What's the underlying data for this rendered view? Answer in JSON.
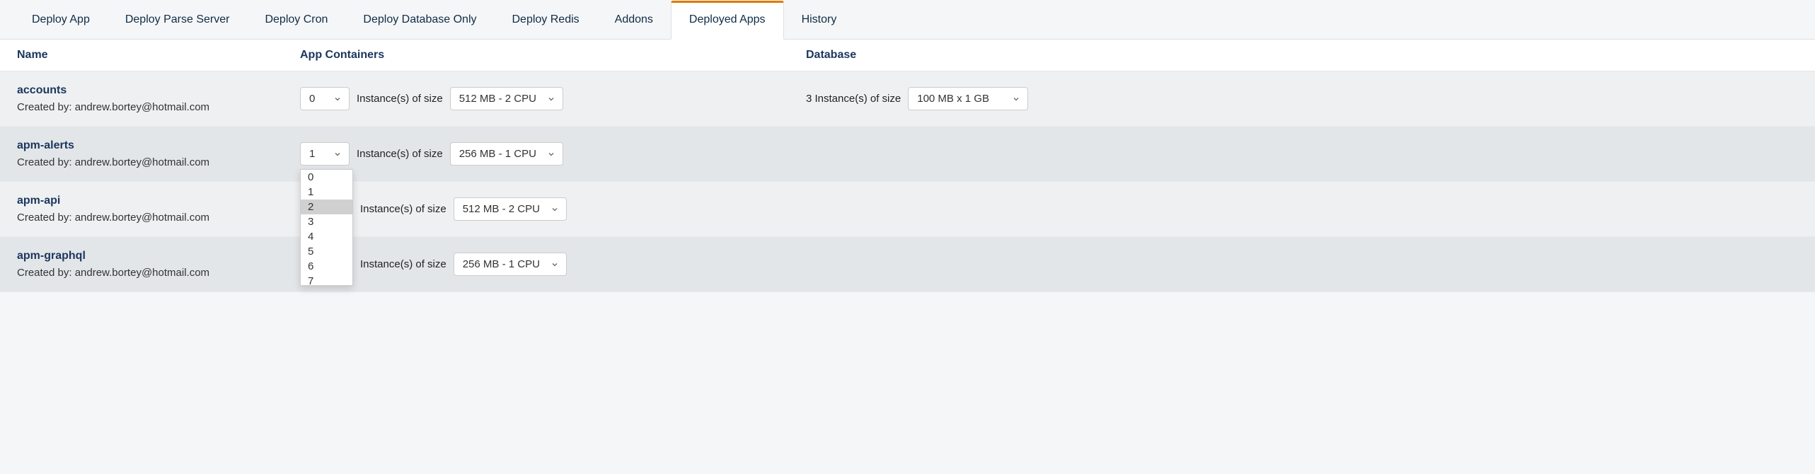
{
  "tabs": [
    {
      "label": "Deploy App",
      "active": false
    },
    {
      "label": "Deploy Parse Server",
      "active": false
    },
    {
      "label": "Deploy Cron",
      "active": false
    },
    {
      "label": "Deploy Database Only",
      "active": false
    },
    {
      "label": "Deploy Redis",
      "active": false
    },
    {
      "label": "Addons",
      "active": false
    },
    {
      "label": "Deployed Apps",
      "active": true
    },
    {
      "label": "History",
      "active": false
    }
  ],
  "headers": {
    "name": "Name",
    "containers": "App Containers",
    "database": "Database"
  },
  "created_by_prefix": "Created by: ",
  "instances_label": "Instance(s) of size",
  "db_instances_prefix": "3 Instance(s) of size",
  "dropdown_options": [
    "0",
    "1",
    "2",
    "3",
    "4",
    "5",
    "6",
    "7"
  ],
  "dropdown_highlight_index": 2,
  "apps": [
    {
      "name": "accounts",
      "created_by": "andrew.bortey@hotmail.com",
      "count": "0",
      "size": "512 MB - 2 CPU",
      "db_size": "100 MB x 1 GB",
      "show_db": true,
      "dropdown_open": false
    },
    {
      "name": "apm-alerts",
      "created_by": "andrew.bortey@hotmail.com",
      "count": "1",
      "size": "256 MB - 1 CPU",
      "show_db": false,
      "dropdown_open": true
    },
    {
      "name": "apm-api",
      "created_by": "andrew.bortey@hotmail.com",
      "count": "",
      "size": "512 MB - 2 CPU",
      "show_db": false,
      "dropdown_open": false,
      "hide_count_select": true
    },
    {
      "name": "apm-graphql",
      "created_by": "andrew.bortey@hotmail.com",
      "count": "",
      "size": "256 MB - 1 CPU",
      "show_db": false,
      "dropdown_open": false,
      "hide_count_select": true
    }
  ]
}
